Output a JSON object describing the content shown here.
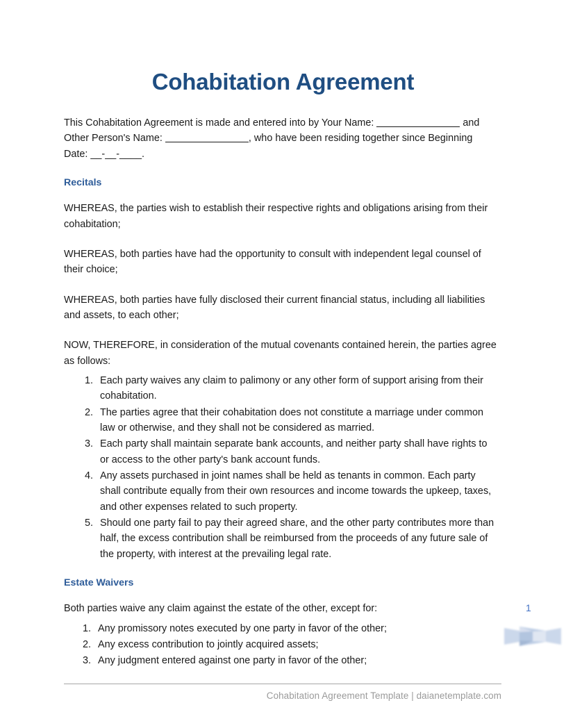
{
  "document": {
    "title": "Cohabitation Agreement",
    "title_color": "#1f4e82",
    "heading_color": "#2e5c99",
    "body_color": "#1a1a1a",
    "page_number": "1",
    "page_number_color": "#4472c4"
  },
  "intro": {
    "part1": "This Cohabitation Agreement is made and entered into by Your Name: ",
    "part2": " and Other Person's Name: ",
    "part3": ", who have been residing together since Beginning Date: __-__-____."
  },
  "recitals": {
    "heading": "Recitals",
    "paragraphs": [
      "WHEREAS, the parties wish to establish their respective rights and obligations arising from their cohabitation;",
      "WHEREAS, both parties have had the opportunity to consult with independent legal counsel of their choice;",
      "WHEREAS, both parties have fully disclosed their current financial status, including all liabilities and assets, to each other;",
      "NOW, THEREFORE, in consideration of the mutual covenants contained herein, the parties agree as follows:"
    ],
    "items": [
      "Each party waives any claim to palimony or any other form of support arising from their cohabitation.",
      "The parties agree that their cohabitation does not constitute a marriage under common law or otherwise, and they shall not be considered as married.",
      "Each party shall maintain separate bank accounts, and neither party shall have rights to or access to the other party's bank account funds.",
      "Any assets purchased in joint names shall be held as tenants in common. Each party shall contribute equally from their own resources and income towards the upkeep, taxes, and other expenses related to such property.",
      "Should one party fail to pay their agreed share, and the other party contributes more than half, the excess contribution shall be reimbursed from the proceeds of any future sale of the property, with interest at the prevailing legal rate."
    ]
  },
  "estate_waivers": {
    "heading": "Estate Waivers",
    "intro": "Both parties waive any claim against the estate of the other, except for:",
    "items": [
      "Any promissory notes executed by one party in favor of the other;",
      "Any excess contribution to jointly acquired assets;",
      "Any judgment entered against one party in favor of the other;"
    ]
  },
  "footer": {
    "text": "Cohabitation Agreement Template | daianetemplate.com"
  }
}
